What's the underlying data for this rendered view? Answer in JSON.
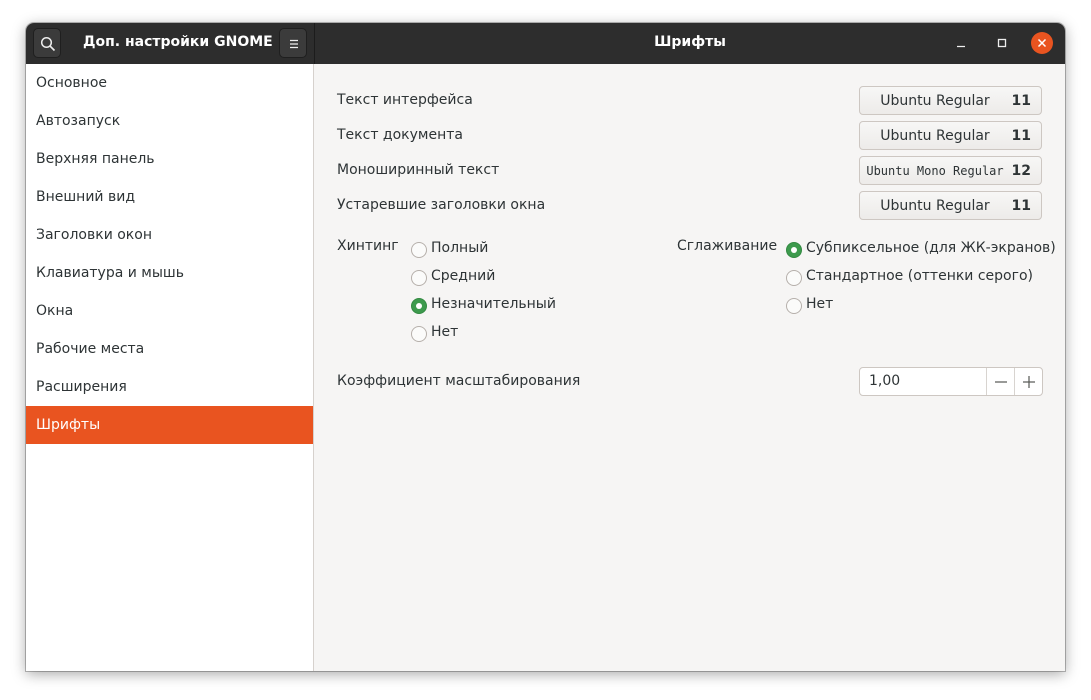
{
  "header": {
    "app_title": "Доп. настройки GNOME",
    "page_title": "Шрифты",
    "search_icon": "search-icon",
    "menu_icon": "hamburger-menu-icon",
    "minimize_icon": "minimize-icon",
    "maximize_icon": "maximize-icon",
    "close_icon": "close-icon",
    "close_color": "#e95420"
  },
  "sidebar": {
    "items": [
      {
        "label": "Основное"
      },
      {
        "label": "Автозапуск"
      },
      {
        "label": "Верхняя панель"
      },
      {
        "label": "Внешний вид"
      },
      {
        "label": "Заголовки окон"
      },
      {
        "label": "Клавиатура и мышь"
      },
      {
        "label": "Окна"
      },
      {
        "label": "Рабочие места"
      },
      {
        "label": "Расширения"
      },
      {
        "label": "Шрифты",
        "active": true
      }
    ],
    "active_color": "#e95420"
  },
  "fonts": {
    "rows": [
      {
        "label": "Текст интерфейса",
        "font": "Ubuntu Regular",
        "size": "11"
      },
      {
        "label": "Текст документа",
        "font": "Ubuntu Regular",
        "size": "11"
      },
      {
        "label": "Моноширинный текст",
        "font": "Ubuntu Mono Regular",
        "size": "12"
      },
      {
        "label": "Устаревшие заголовки окна",
        "font": "Ubuntu Regular",
        "size": "11"
      }
    ]
  },
  "hinting": {
    "label": "Хинтинг",
    "options": [
      "Полный",
      "Средний",
      "Незначительный",
      "Нет"
    ],
    "selected": "Незначительный"
  },
  "antialiasing": {
    "label": "Сглаживание",
    "options": [
      "Субпиксельное (для ЖК-экранов)",
      "Стандартное (оттенки серого)",
      "Нет"
    ],
    "selected": "Субпиксельное (для ЖК-экранов)"
  },
  "scaling": {
    "label": "Коэффициент масштабирования",
    "value": "1,00",
    "decrement_icon": "minus-icon",
    "increment_icon": "plus-icon"
  },
  "accent_color": "#3d9a4d"
}
